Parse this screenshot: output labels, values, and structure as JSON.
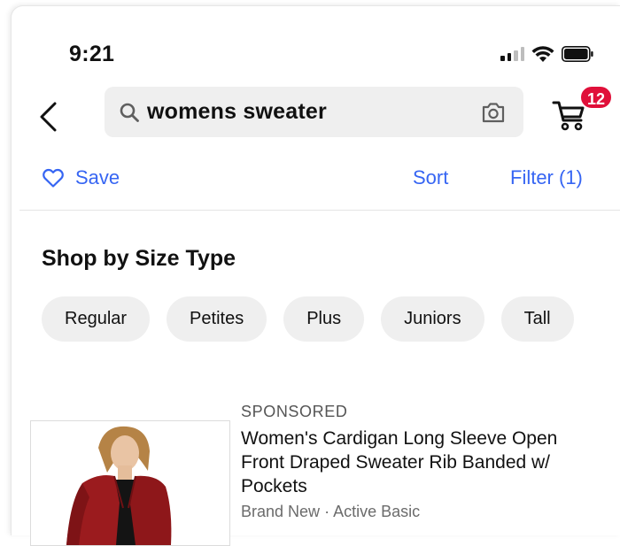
{
  "status_bar": {
    "time": "9:21",
    "icons": [
      "signal-icon",
      "wifi-icon",
      "battery-icon"
    ]
  },
  "header": {
    "back_icon": "chevron-left-icon",
    "search": {
      "query": "womens sweater",
      "search_icon": "search-icon",
      "camera_icon": "camera-icon"
    },
    "cart": {
      "icon": "cart-icon",
      "count": "12"
    }
  },
  "actions": {
    "save_label": "Save",
    "sort_label": "Sort",
    "filter_label": "Filter (1)"
  },
  "size_type": {
    "title": "Shop by Size Type",
    "chips": [
      "Regular",
      "Petites",
      "Plus",
      "Juniors",
      "Tall"
    ]
  },
  "listing": {
    "sponsored": "SPONSORED",
    "title": "Women's Cardigan Long Sleeve Open Front Draped Sweater Rib Banded w/ Pockets",
    "condition": "Brand New",
    "separator": "·",
    "seller": "Active Basic"
  },
  "colors": {
    "accent": "#3665f3",
    "badge": "#e0103a",
    "chip_bg": "#efefef",
    "cardigan": "#9b1b1e"
  }
}
